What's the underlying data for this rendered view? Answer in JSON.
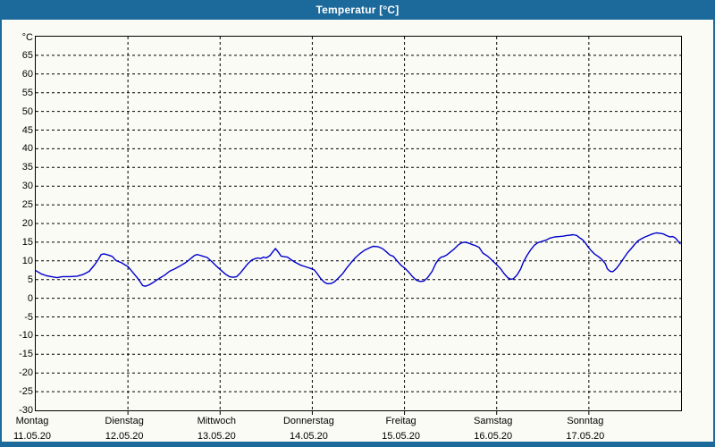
{
  "window": {
    "title": "Temperatur [°C]"
  },
  "colors": {
    "titlebar": "#1c6a9c",
    "frame": "#1c6a9c",
    "background": "#fbfbf5",
    "line": "#0000cd",
    "grid": "#000000",
    "title_text": "#ffffff",
    "axis_text": "#000000"
  },
  "chart_data": {
    "type": "line",
    "title": "Temperatur [°C]",
    "ylabel": "°C",
    "legend": "none",
    "y_axis": {
      "plot_min": -30,
      "plot_max": 70,
      "tick_min": -30,
      "tick_max": 65,
      "tick_step": 5,
      "grid": "dashed"
    },
    "x_axis": {
      "grid": "dashed",
      "days": [
        {
          "name": "Montag",
          "date": "11.05.20"
        },
        {
          "name": "Dienstag",
          "date": "12.05.20"
        },
        {
          "name": "Mittwoch",
          "date": "13.05.20"
        },
        {
          "name": "Donnerstag",
          "date": "14.05.20"
        },
        {
          "name": "Freitag",
          "date": "15.05.20"
        },
        {
          "name": "Samstag",
          "date": "16.05.20"
        },
        {
          "name": "Sonntag",
          "date": "17.05.20"
        }
      ]
    },
    "series": [
      {
        "name": "Temperatur",
        "unit": "°C",
        "color": "#0000cd",
        "points_day_temp": [
          [
            0,
            7.4
          ],
          [
            0.06,
            6.5
          ],
          [
            0.12,
            6
          ],
          [
            0.17,
            5.8
          ],
          [
            0.23,
            5.5
          ],
          [
            0.29,
            5.8
          ],
          [
            0.37,
            5.8
          ],
          [
            0.45,
            5.9
          ],
          [
            0.52,
            6.4
          ],
          [
            0.58,
            7.2
          ],
          [
            0.64,
            9
          ],
          [
            0.68,
            10.4
          ],
          [
            0.71,
            11.7
          ],
          [
            0.74,
            11.9
          ],
          [
            0.78,
            11.6
          ],
          [
            0.83,
            11.2
          ],
          [
            0.87,
            10.1
          ],
          [
            0.93,
            9.5
          ],
          [
            0.97,
            8.9
          ],
          [
            1,
            8.5
          ],
          [
            1.05,
            7
          ],
          [
            1.1,
            5.5
          ],
          [
            1.13,
            4.5
          ],
          [
            1.16,
            3.4
          ],
          [
            1.19,
            3.2
          ],
          [
            1.23,
            3.6
          ],
          [
            1.28,
            4.3
          ],
          [
            1.34,
            5.3
          ],
          [
            1.4,
            6.2
          ],
          [
            1.45,
            7.2
          ],
          [
            1.51,
            7.9
          ],
          [
            1.57,
            8.7
          ],
          [
            1.63,
            9.6
          ],
          [
            1.68,
            10.6
          ],
          [
            1.72,
            11.4
          ],
          [
            1.75,
            11.7
          ],
          [
            1.78,
            11.5
          ],
          [
            1.82,
            11.2
          ],
          [
            1.86,
            10.9
          ],
          [
            1.91,
            9.8
          ],
          [
            1.96,
            8.6
          ],
          [
            2.01,
            7.5
          ],
          [
            2.06,
            6.4
          ],
          [
            2.1,
            5.8
          ],
          [
            2.14,
            5.6
          ],
          [
            2.18,
            5.8
          ],
          [
            2.22,
            6.8
          ],
          [
            2.26,
            8
          ],
          [
            2.3,
            9.2
          ],
          [
            2.34,
            10.2
          ],
          [
            2.38,
            10.6
          ],
          [
            2.41,
            10.8
          ],
          [
            2.44,
            10.6
          ],
          [
            2.47,
            11
          ],
          [
            2.5,
            10.8
          ],
          [
            2.54,
            11.4
          ],
          [
            2.57,
            12.4
          ],
          [
            2.6,
            13.3
          ],
          [
            2.63,
            12.4
          ],
          [
            2.66,
            11.3
          ],
          [
            2.7,
            11.1
          ],
          [
            2.73,
            11
          ],
          [
            2.77,
            10.3
          ],
          [
            2.81,
            9.7
          ],
          [
            2.87,
            8.9
          ],
          [
            2.93,
            8.4
          ],
          [
            2.98,
            8
          ],
          [
            3.02,
            7.6
          ],
          [
            3.05,
            6.7
          ],
          [
            3.09,
            5.3
          ],
          [
            3.13,
            4.3
          ],
          [
            3.16,
            3.9
          ],
          [
            3.2,
            3.9
          ],
          [
            3.24,
            4.4
          ],
          [
            3.28,
            5.3
          ],
          [
            3.33,
            6.6
          ],
          [
            3.37,
            8
          ],
          [
            3.42,
            9.5
          ],
          [
            3.47,
            10.9
          ],
          [
            3.52,
            12
          ],
          [
            3.57,
            12.9
          ],
          [
            3.62,
            13.5
          ],
          [
            3.66,
            13.9
          ],
          [
            3.71,
            13.8
          ],
          [
            3.76,
            13.3
          ],
          [
            3.8,
            12.5
          ],
          [
            3.84,
            11.6
          ],
          [
            3.88,
            11.2
          ],
          [
            3.92,
            10
          ],
          [
            3.96,
            8.9
          ],
          [
            4.01,
            7.9
          ],
          [
            4.05,
            6.9
          ],
          [
            4.09,
            5.7
          ],
          [
            4.13,
            4.8
          ],
          [
            4.17,
            4.5
          ],
          [
            4.21,
            4.6
          ],
          [
            4.25,
            5.5
          ],
          [
            4.3,
            7.2
          ],
          [
            4.34,
            9.3
          ],
          [
            4.37,
            10.4
          ],
          [
            4.4,
            11
          ],
          [
            4.43,
            11.2
          ],
          [
            4.46,
            11.6
          ],
          [
            4.5,
            12.4
          ],
          [
            4.54,
            13.2
          ],
          [
            4.58,
            14.2
          ],
          [
            4.62,
            14.8
          ],
          [
            4.65,
            15
          ],
          [
            4.69,
            14.8
          ],
          [
            4.73,
            14.4
          ],
          [
            4.77,
            14.1
          ],
          [
            4.81,
            13.6
          ],
          [
            4.85,
            12.1
          ],
          [
            4.9,
            11.3
          ],
          [
            4.94,
            10.4
          ],
          [
            4.99,
            9.2
          ],
          [
            5.04,
            8
          ],
          [
            5.08,
            6.6
          ],
          [
            5.12,
            5.5
          ],
          [
            5.15,
            5.1
          ],
          [
            5.18,
            5.2
          ],
          [
            5.22,
            6.2
          ],
          [
            5.26,
            7.8
          ],
          [
            5.29,
            9.7
          ],
          [
            5.33,
            11.5
          ],
          [
            5.37,
            13
          ],
          [
            5.41,
            14.2
          ],
          [
            5.45,
            14.9
          ],
          [
            5.49,
            15.2
          ],
          [
            5.54,
            15.6
          ],
          [
            5.58,
            16.1
          ],
          [
            5.63,
            16.4
          ],
          [
            5.68,
            16.5
          ],
          [
            5.72,
            16.6
          ],
          [
            5.76,
            16.8
          ],
          [
            5.8,
            16.9
          ],
          [
            5.83,
            17
          ],
          [
            5.87,
            16.8
          ],
          [
            5.9,
            16.2
          ],
          [
            5.93,
            15.7
          ],
          [
            5.96,
            14.9
          ],
          [
            5.99,
            13.8
          ],
          [
            6.02,
            12.9
          ],
          [
            6.06,
            11.9
          ],
          [
            6.1,
            11.2
          ],
          [
            6.14,
            10.4
          ],
          [
            6.18,
            9.2
          ],
          [
            6.2,
            7.9
          ],
          [
            6.23,
            7.2
          ],
          [
            6.26,
            7.1
          ],
          [
            6.3,
            8
          ],
          [
            6.34,
            9.3
          ],
          [
            6.38,
            10.8
          ],
          [
            6.42,
            12.2
          ],
          [
            6.46,
            13.3
          ],
          [
            6.5,
            14.5
          ],
          [
            6.53,
            15.3
          ],
          [
            6.57,
            15.9
          ],
          [
            6.61,
            16.4
          ],
          [
            6.65,
            16.8
          ],
          [
            6.69,
            17.2
          ],
          [
            6.73,
            17.5
          ],
          [
            6.77,
            17.4
          ],
          [
            6.81,
            17.2
          ],
          [
            6.84,
            16.8
          ],
          [
            6.88,
            16.4
          ],
          [
            6.91,
            16.5
          ],
          [
            6.94,
            16.1
          ],
          [
            6.97,
            15.2
          ],
          [
            6.99,
            14.6
          ]
        ]
      }
    ]
  }
}
